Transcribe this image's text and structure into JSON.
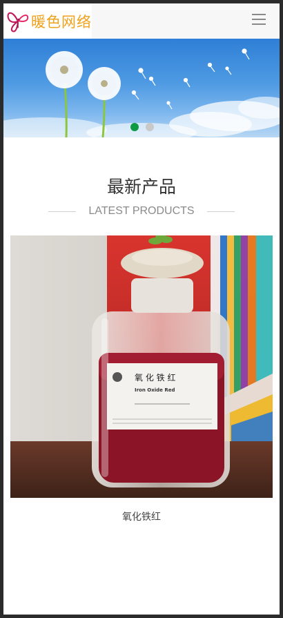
{
  "header": {
    "logo_text": "暖色网络",
    "menu_icon": "hamburger-menu-icon"
  },
  "banner": {
    "slide_count": 2,
    "active_slide": 1,
    "colors": {
      "active_dot": "#0d9a45",
      "inactive_dot": "#c9c9c9"
    }
  },
  "section": {
    "title": "最新产品",
    "subtitle": "LATEST PRODUCTS"
  },
  "products": [
    {
      "name": "氧化铁红",
      "label_title": "氧 化 铁 红",
      "label_subtitle": "Iron Oxide Red"
    }
  ]
}
